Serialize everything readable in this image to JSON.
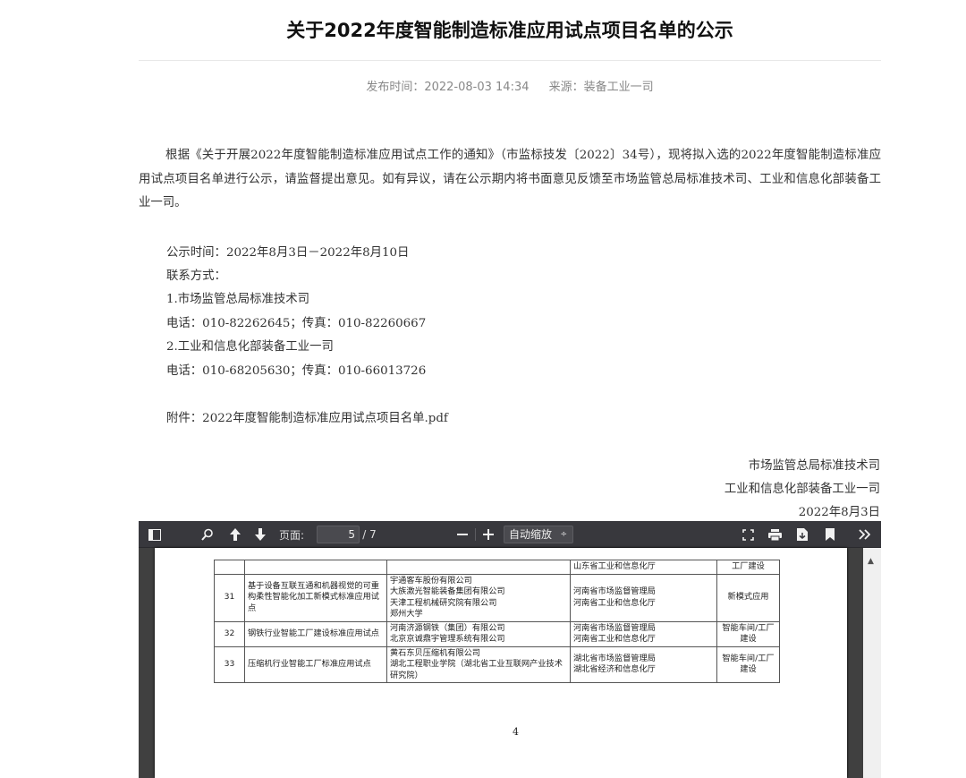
{
  "article": {
    "title": "关于2022年度智能制造标准应用试点项目名单的公示",
    "publish_time": "发布时间：2022-08-03 14:34",
    "source": "来源：装备工业一司",
    "paragraph": "根据《关于开展2022年度智能制造标准应用试点工作的通知》（市监标技发〔2022〕34号），现将拟入选的2022年度智能制造标准应用试点项目名单进行公示，请监督提出意见。如有异议，请在公示期内将书面意见反馈至市场监管总局标准技术司、工业和信息化部装备工业一司。",
    "notice_period": "公示时间：2022年8月3日－2022年8月10日",
    "contact_heading": "联系方式：",
    "contact1_org": "1.市场监管总局标准技术司",
    "contact1_phone": "电话：010-82262645；传真：010-82260667",
    "contact2_org": "2.工业和信息化部装备工业一司",
    "contact2_phone": "电话：010-68205630；传真：010-66013726",
    "attachment": "附件：2022年度智能制造标准应用试点项目名单.pdf",
    "sign_org1": "市场监管总局标准技术司",
    "sign_org2": "工业和信息化部装备工业一司",
    "sign_date": "2022年8月3日"
  },
  "viewer": {
    "page_label": "页面:",
    "page_current": "5",
    "page_total": "/ 7",
    "zoom_value": "自动缩放",
    "zoom_arrow": "÷",
    "page_number_footer": "4",
    "cut_row": {
      "authority": "山东省工业和信息化厅",
      "category": "工厂建设"
    },
    "rows": [
      {
        "num": "31",
        "name": "基于设备互联互通和机器视觉的可重构柔性智能化加工新模式标准应用试点",
        "orgs": [
          "宇通客车股份有限公司",
          "大族激光智能装备集团有限公司",
          "天津工程机械研究院有限公司",
          "郑州大学"
        ],
        "authorities": [
          "河南省市场监督管理局",
          "河南省工业和信息化厅"
        ],
        "category": "新模式应用"
      },
      {
        "num": "32",
        "name": "钢铁行业智能工厂建设标准应用试点",
        "orgs": [
          "河南济源钢铁（集团）有限公司",
          "北京京诚鼎宇管理系统有限公司"
        ],
        "authorities": [
          "河南省市场监督管理局",
          "河南省工业和信息化厅"
        ],
        "category": "智能车间/工厂建设"
      },
      {
        "num": "33",
        "name": "压缩机行业智能工厂标准应用试点",
        "orgs": [
          "黄石东贝压缩机有限公司",
          "湖北工程职业学院（湖北省工业互联网产业技术研究院）"
        ],
        "authorities": [
          "湖北省市场监督管理局",
          "湖北省经济和信息化厅"
        ],
        "category": "智能车间/工厂建设"
      }
    ]
  }
}
